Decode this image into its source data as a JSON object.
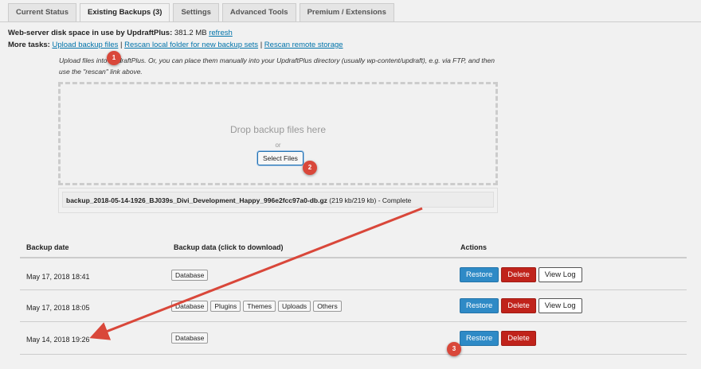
{
  "tabs": [
    "Current Status",
    "Existing Backups (3)",
    "Settings",
    "Advanced Tools",
    "Premium / Extensions"
  ],
  "disk": {
    "label": "Web-server disk space in use by UpdraftPlus:",
    "value": "381.2 MB",
    "refresh": "refresh"
  },
  "tasks": {
    "label": "More tasks:",
    "links": [
      "Upload backup files",
      "Rescan local folder for new backup sets",
      "Rescan remote storage"
    ],
    "sep": "|"
  },
  "upload_note": "Upload files into UpdraftPlus. Or, you can place them manually into your UpdraftPlus directory (usually wp-content/updraft), e.g. via FTP, and then use the \"rescan\" link above.",
  "drop": {
    "text": "Drop backup files here",
    "or": "or",
    "select": "Select Files"
  },
  "file": {
    "name": "backup_2018-05-14-1926_BJ039s_Divi_Development_Happy_996e2fcc97a0-db.gz",
    "progress": "(219 kb/219 kb) - Complete"
  },
  "table": {
    "headers": [
      "Backup date",
      "Backup data (click to download)",
      "Actions"
    ],
    "rows": [
      {
        "date": "May 17, 2018 18:41",
        "data": [
          "Database"
        ],
        "log": true
      },
      {
        "date": "May 17, 2018 18:05",
        "data": [
          "Database",
          "Plugins",
          "Themes",
          "Uploads",
          "Others"
        ],
        "log": true
      },
      {
        "date": "May 14, 2018 19:26",
        "data": [
          "Database"
        ],
        "log": false
      }
    ]
  },
  "actions": {
    "restore": "Restore",
    "delete": "Delete",
    "log": "View Log"
  },
  "badges": [
    "1",
    "2",
    "3"
  ],
  "colors": {
    "annotation": "#d9473a",
    "restore": "#2e8ac6",
    "delete": "#c0231b"
  }
}
